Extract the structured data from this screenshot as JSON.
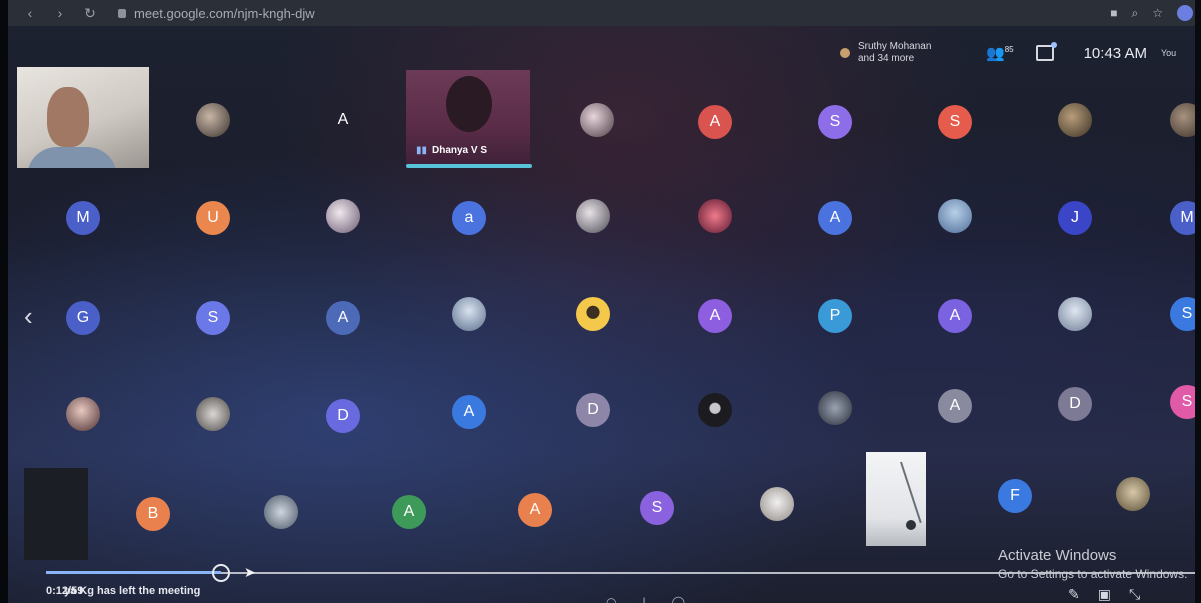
{
  "browser": {
    "back_label": "‹",
    "forward_label": "›",
    "reload_label": "↻",
    "url": "meet.google.com/njm-kngh-djw"
  },
  "topbar": {
    "presenter_name": "Sruthy Mohanan",
    "presenter_extra": "and 34 more",
    "participant_count": "85",
    "time": "10:43 AM",
    "you_label": "You"
  },
  "tiles": {
    "dhanya_name": "Dhanya V S"
  },
  "avatars": {
    "row1": [
      "",
      "A",
      "",
      "A",
      "S",
      "S",
      "",
      ""
    ],
    "row2": [
      "M",
      "U",
      "",
      "a",
      "",
      "",
      "A",
      "",
      "J",
      "M"
    ],
    "row3": [
      "G",
      "S",
      "A",
      "",
      "",
      "A",
      "P",
      "A",
      "",
      "S"
    ],
    "row4": [
      "",
      "",
      "D",
      "A",
      "D",
      "",
      "",
      "A",
      "D",
      "S"
    ],
    "row5": [
      "B",
      "",
      "A",
      "A",
      "S",
      "",
      "F",
      ""
    ]
  },
  "overlay": {
    "time_label": "0:12/59",
    "toast": "ya Kg has left the meeting",
    "activate_title": "Activate Windows",
    "activate_sub": "Go to Settings to activate Windows."
  },
  "colors": {
    "accent": "#8ab4f8",
    "active_speaker": "#57c3d8"
  }
}
